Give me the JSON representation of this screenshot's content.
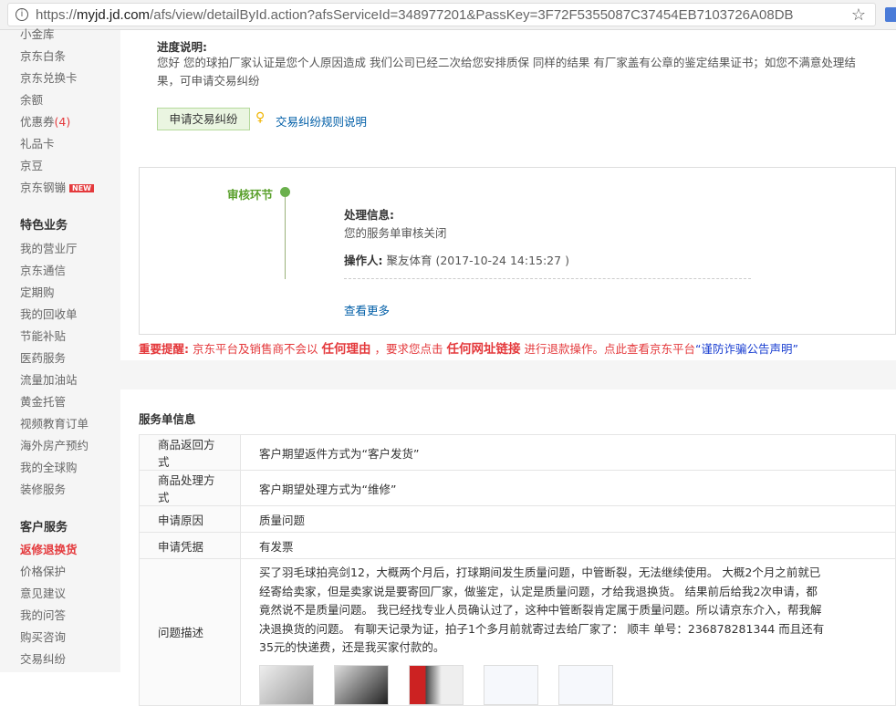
{
  "browser": {
    "url_host": "myjd.jd.com",
    "url_prefix": "https://",
    "url_path": "/afs/view/detailById.action?afsServiceId=348977201&PassKey=3F72F5355087C37454EB7103726A08DB"
  },
  "sidebar": {
    "items_top": [
      "小金库",
      "京东白条",
      "京东兑换卡",
      "余额",
      "优惠券",
      "礼品卡",
      "京豆",
      "京东钢镚"
    ],
    "coupon_count": "(4)",
    "new_badge": "NEW",
    "section2": "特色业务",
    "items2": [
      "我的营业厅",
      "京东通信",
      "定期购",
      "我的回收单",
      "节能补贴",
      "医药服务",
      "流量加油站",
      "黄金托管",
      "视频教育订单",
      "海外房产预约",
      "我的全球购",
      "装修服务"
    ],
    "section3": "客户服务",
    "items3": [
      "返修退换货",
      "价格保护",
      "意见建议",
      "我的问答",
      "购买咨询",
      "交易纠纷"
    ]
  },
  "progress": {
    "title": "进度说明:",
    "text": "您好 您的球拍厂家认证是您个人原因造成 我们公司已经二次给您安排质保 同样的结果 有厂家盖有公章的鉴定结果证书；如您不满意处理结果，可申请交易纠纷",
    "apply_button": "申请交易纠纷",
    "rules_link": "交易纠纷规则说明"
  },
  "timeline": {
    "stage": "审核环节",
    "info_label": "处理信息:",
    "info_text": "您的服务单审核关闭",
    "operator_label": "操作人:",
    "operator": "聚友体育 (2017-10-24 14:15:27 )",
    "more": "查看更多"
  },
  "warning": {
    "label": "重要提醒:",
    "t1": "京东平台及销售商不会以",
    "b1": "任何理由",
    "t2": "，要求您点击",
    "b2": "任何网址链接",
    "t3": "进行退款操作。点此查看京东平台",
    "link": "“谨防诈骗公告声明”"
  },
  "service": {
    "title": "服务单信息",
    "rows": [
      {
        "label": "商品返回方式",
        "value": "客户期望返件方式为“客户发货”"
      },
      {
        "label": "商品处理方式",
        "value": "客户期望处理方式为“维修”"
      },
      {
        "label": "申请原因",
        "value": "质量问题"
      },
      {
        "label": "申请凭据",
        "value": "有发票"
      }
    ],
    "desc_label": "问题描述",
    "desc": "买了羽毛球拍亮剑12，大概两个月后，打球期间发生质量问题，中管断裂，无法继续使用。 大概2个月之前就已经寄给卖家，但是卖家说是要寄回厂家，做鉴定，认定是质量问题，才给我退换货。 结果前后给我2次申请，都竟然说不是质量问题。 我已经找专业人员确认过了，这种中管断裂肯定属于质量问题。所以请京东介入，帮我解决退换货的问题。 有聊天记录为证，拍子1个多月前就寄过去给厂家了： 顺丰 单号：236878281344 而且还有35元的快递费，还是我买家付款的。"
  }
}
